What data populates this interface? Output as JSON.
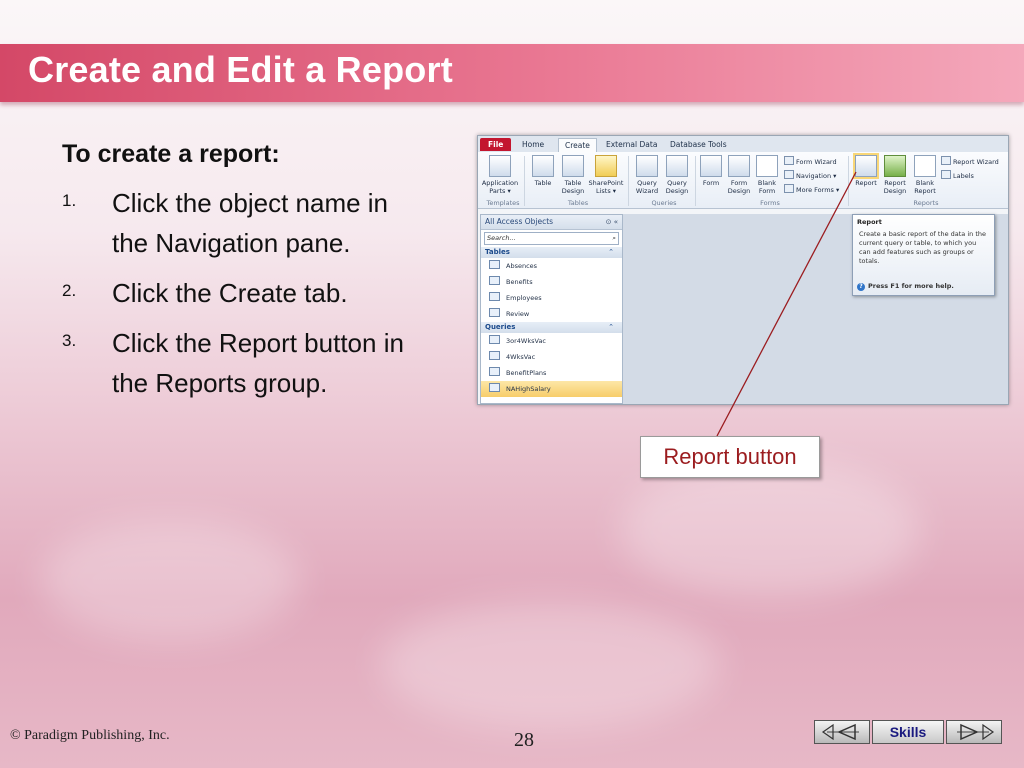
{
  "slide": {
    "title": "Create and Edit a Report",
    "lead": "To create a report:",
    "steps": [
      {
        "num": "1.",
        "text": "Click the object name in the Navigation pane."
      },
      {
        "num": "2.",
        "text": "Click the Create tab."
      },
      {
        "num": "3.",
        "text": "Click the Report button in the Reports group."
      }
    ],
    "callout": "Report button",
    "copyright": "© Paradigm Publishing, Inc.",
    "page_number": "28",
    "nav": {
      "skills_label": "Skills",
      "prev_icon": "triangle-left-icon",
      "next_icon": "triangle-right-icon"
    }
  },
  "access": {
    "tabs": [
      "File",
      "Home",
      "Create",
      "External Data",
      "Database Tools"
    ],
    "ribbon": {
      "application_parts": "Application Parts ▾",
      "table": "Table",
      "table_design": "Table Design",
      "sharepoint_lists": "SharePoint Lists ▾",
      "query_wizard": "Query Wizard",
      "query_design": "Query Design",
      "form": "Form",
      "form_design": "Form Design",
      "blank_form": "Blank Form",
      "form_wizard": "Form Wizard",
      "navigation": "Navigation ▾",
      "more_forms": "More Forms ▾",
      "report": "Report",
      "report_design": "Report Design",
      "blank_report": "Blank Report",
      "report_wizard": "Report Wizard",
      "labels": "Labels",
      "groups": [
        "Templates",
        "Tables",
        "Queries",
        "Forms",
        "Reports"
      ]
    },
    "nav_pane": {
      "header": "All Access Objects",
      "search_placeholder": "Search...",
      "sections": [
        {
          "name": "Tables",
          "items": [
            "Absences",
            "Benefits",
            "Employees",
            "Review"
          ]
        },
        {
          "name": "Queries",
          "items": [
            "3or4WksVac",
            "4WksVac",
            "BenefitPlans",
            "NAHighSalary"
          ]
        }
      ]
    },
    "tooltip": {
      "title": "Report",
      "body": "Create a basic report of the data in the current query or table, to which you can add features such as groups or totals.",
      "help": "Press F1 for more help."
    }
  },
  "colors": {
    "accent": "#d44867",
    "callout_text": "#9b1c1f",
    "file_tab": "#c3162f"
  }
}
